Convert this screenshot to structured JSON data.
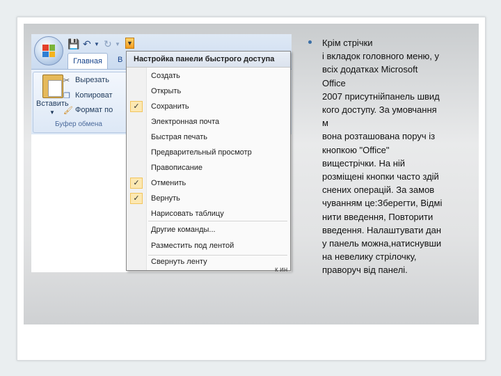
{
  "app": {
    "tabs": [
      "Главная",
      "В"
    ],
    "clipboard_group": {
      "paste_label": "Вставить",
      "commands": [
        "Вырезать",
        "Копироват",
        "Формат по"
      ],
      "group_label": "Буфер обмена"
    }
  },
  "menu": {
    "title": "Настройка панели быстрого доступа",
    "items": [
      {
        "label": "Создать",
        "checked": false
      },
      {
        "label": "Открыть",
        "checked": false
      },
      {
        "label": "Сохранить",
        "checked": true
      },
      {
        "label": "Электронная почта",
        "checked": false
      },
      {
        "label": "Быстрая печать",
        "checked": false
      },
      {
        "label": "Предварительный просмотр",
        "checked": false
      },
      {
        "label": "Правописание",
        "checked": false
      },
      {
        "label": "Отменить",
        "checked": true
      },
      {
        "label": "Вернуть",
        "checked": true
      },
      {
        "label": "Нарисовать таблицу",
        "checked": false
      }
    ],
    "extra_items": [
      "Другие команды...",
      "Разместить под лентой",
      "Свернуть ленту"
    ],
    "check_glyph": "✓"
  },
  "stray_text": "к ин",
  "slide_text": {
    "lines": [
      "Крім стрічки",
      "і вкладок головного меню, у",
      "всіх додатках Microsoft",
      "Office",
      "2007 присутнійпанель швид",
      "кого доступу. За умовчання",
      "м",
      "вона розташована поруч із",
      "кнопкою \"Office\"",
      "вищестрічки. На ній",
      "розміщені кнопки часто здій",
      "снених операцій. За замов",
      "чуванням це:Зберегти, Відмі",
      "нити введення, Повторити",
      "введення. Налаштувати дан",
      "у панель можна,натиснувши",
      " на невелику стрілочку,",
      "праворуч від панелі."
    ]
  },
  "colors": {
    "accent": "#15428b",
    "bullet": "#3b6fa6",
    "check_bg": "#fce8b2"
  }
}
